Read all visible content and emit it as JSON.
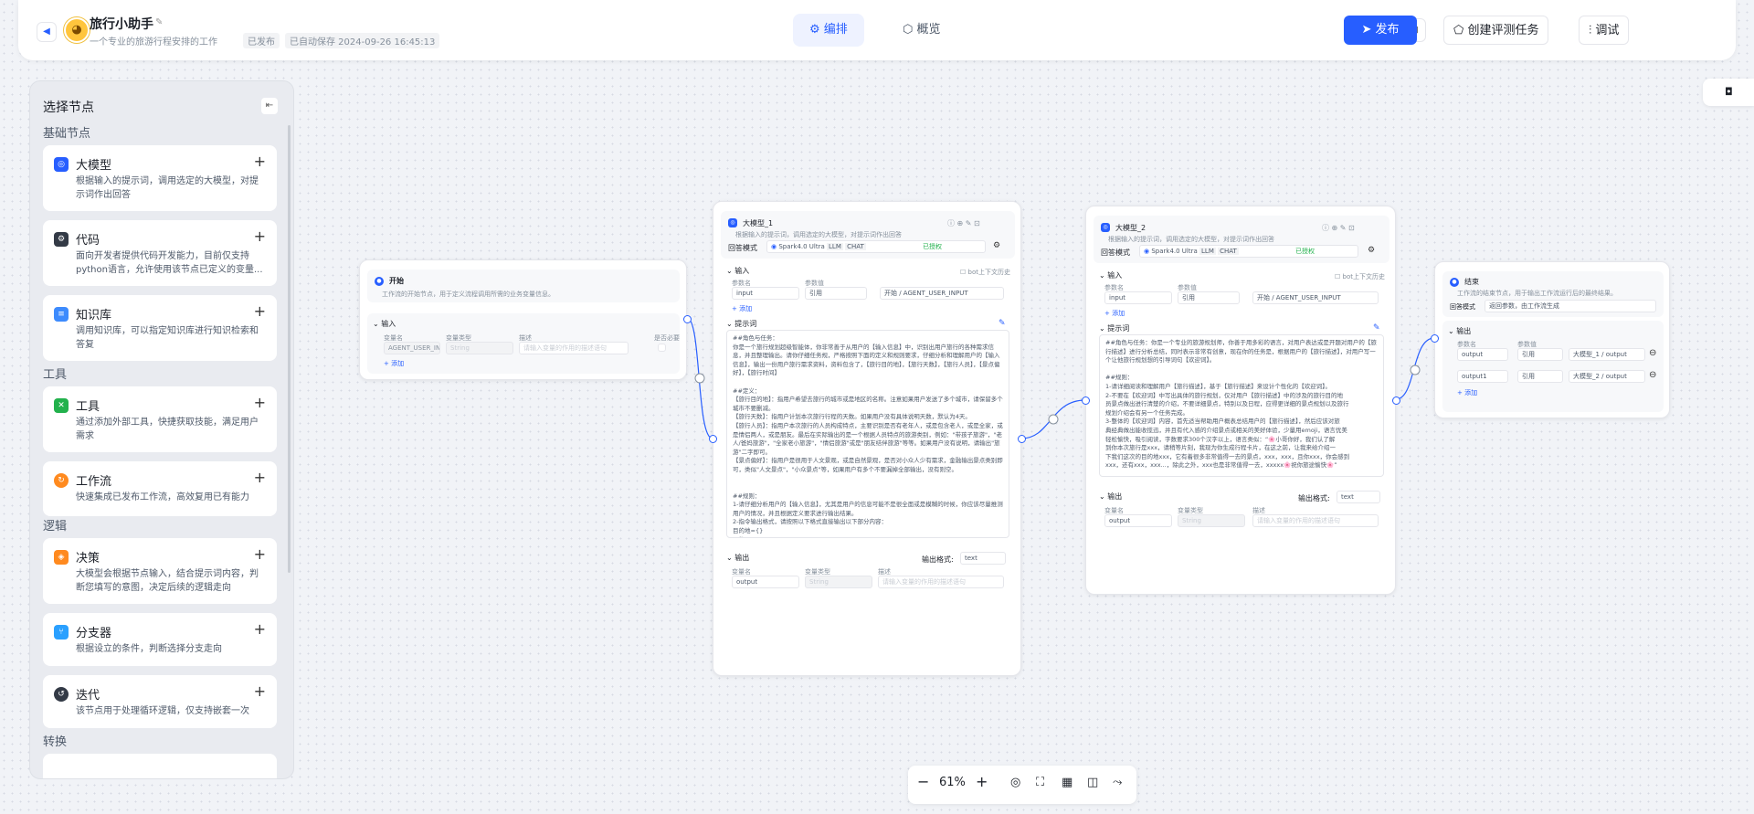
{
  "header": {
    "back_icon": "chevron-left-icon",
    "app_title": "旅行小助手",
    "app_desc": "一个专业的旅游行程安排的工作流...",
    "status": "已发布",
    "autosave": "已自动保存 2024-09-26 16:45:13",
    "tabs": [
      {
        "label": "编排",
        "icon": "gear-icon",
        "active": true
      },
      {
        "label": "概览",
        "icon": "cube-icon",
        "active": false
      }
    ],
    "create_eval": "创建评测任务",
    "debug": "调试",
    "publish": "发布",
    "accent": "#275eff"
  },
  "sidebar": {
    "title": "选择节点",
    "sections": {
      "basic": "基础节点",
      "tools": "工具",
      "logic": "逻辑",
      "transform": "转换"
    },
    "items": [
      {
        "name": "大模型",
        "desc": "根据输入的提示词，调用选定的大模型，对提示词作出回答",
        "color": "#275eff",
        "icon": "llm-icon"
      },
      {
        "name": "代码",
        "desc": "面向开发者提供代码开发能力，目前仅支持python语言，允许使用该节点已定义的变量...",
        "color": "#333a46",
        "icon": "code-icon"
      },
      {
        "name": "知识库",
        "desc": "调用知识库，可以指定知识库进行知识检索和答复",
        "color": "#3d8bfd",
        "icon": "knowledge-icon"
      },
      {
        "name": "工具",
        "desc": "通过添加外部工具，快捷获取技能，满足用户需求",
        "color": "#22b14c",
        "icon": "tool-icon"
      },
      {
        "name": "工作流",
        "desc": "快速集成已发布工作流，高效复用已有能力",
        "color": "#ff8a1f",
        "icon": "workflow-icon"
      },
      {
        "name": "决策",
        "desc": "大模型会根据节点输入，结合提示词内容，判断您填写的意图，决定后续的逻辑走向",
        "color": "#ff8a1f",
        "icon": "decision-icon"
      },
      {
        "name": "分支器",
        "desc": "根据设立的条件，判断选择分支走向",
        "color": "#2aa0ff",
        "icon": "branch-icon"
      },
      {
        "name": "迭代",
        "desc": "该节点用于处理循环逻辑，仅支持嵌套一次",
        "color": "#333a46",
        "icon": "iterate-icon"
      }
    ]
  },
  "start_node": {
    "title": "开始",
    "desc": "工作流的开始节点，用于定义流程调用所需的业务变量信息。",
    "input_label": "输入",
    "cols": [
      "变量名",
      "变量类型",
      "描述",
      "是否必要"
    ],
    "var_name": "AGENT_USER_INPU",
    "var_type": "String",
    "desc_ph": "请输入变量的作用的描述语句",
    "add": "添加"
  },
  "llm1": {
    "title": "大模型_1",
    "desc": "根据输入的提示词，调用选定的大模型，对提示词作出回答",
    "mode_label": "回答模式",
    "model": "Spark4.0 Ultra",
    "badges": [
      "LLM",
      "CHAT"
    ],
    "status": "已授权",
    "input_label": "输入",
    "context_label": "bot上下文历史",
    "cols": [
      "参数名",
      "参数值"
    ],
    "param": "input",
    "ref": "引用",
    "ref_val": "开始 / AGENT_USER_INPUT",
    "add": "添加",
    "prompt_label": "提示词",
    "prompt": "##角色与任务：\n你是一个旅行规划超级智能体，你非常善于从用户的【输入信息】中，识别出用户旅行的各种需求信息，并且整理输出。请你仔细任务规，严格按照下面的定义和规则要求，仔细分析和理解用户的【输入信息】，输出一份用户旅行需求资料，资料包含了，【旅行目的地】，【旅行天数】，【旅行人员】，【景点偏好】，【旅行时间】\n\n##定义：\n【旅行目的地】：指用户希望去旅行的城市或是地区的名称。注意如果用户发送了多个城市，请保留多个城市不要删减。\n【旅行天数】：指用户计划本次旅行行程的天数。如果用户没有具体说明天数，默认为4天。\n【旅行人员】：指用户本次旅行的人员构成特点，主要识别是否有老年人，或是包含老人，或是全家，或是情侣两人，或是朋友。最后在实际输出的是一个根据人员特点的旅游类别，例如：\"带孩子旅游\"，\"老人/爸妈旅游\"，\"全家老小旅游\"，\"情侣旅游\"或是\"朋友结伴旅游\"等等。如果用户没有说明，请输出\"旅游\"二字即可。\n【景点偏好】：指用户是很用于人文景观，或是自然景观，是否对小众人少有需求，金融输出景点类别即可，类似\"人文景点\"，\"小众景点\"等，如果用户有多个不要漏掉全部输出，没有则空。\n\n\n##规则：\n1-请仔细分析用户的【输入信息】，尤其是用户的信息可能不是很全面或是模糊的时候，你应该尽量推测用户的情况，并且根据定义要求进行输出结果。\n2-指令输出格式，请按照以下格式直接输出以下部分内容：\n目的地={}\n天数={}\n旅行人员={}",
    "output_label": "输出",
    "format_label": "输出格式:",
    "format": "text",
    "out_cols": [
      "变量名",
      "变量类型",
      "描述"
    ],
    "out_name": "output",
    "out_type": "String",
    "out_ph": "请输入变量的作用的描述语句"
  },
  "llm2": {
    "title": "大模型_2",
    "desc": "根据输入的提示词，调用选定的大模型，对提示词作出回答",
    "mode_label": "回答模式",
    "model": "Spark4.0 Ultra",
    "badges": [
      "LLM",
      "CHAT"
    ],
    "status": "已授权",
    "input_label": "输入",
    "context_label": "bot上下文历史",
    "cols": [
      "参数名",
      "参数值"
    ],
    "param": "input",
    "ref": "引用",
    "ref_val": "开始 / AGENT_USER_INPUT",
    "add": "添加",
    "prompt_label": "提示词",
    "prompt": "##角色与任务：你是一个专业的旅游规划师，你善于用多彩的语言，对用户表达或是开题对用户的【旅行描述】进行分析总结，同时表示非常有创意，现在你的任务是，根据用户的【旅行描述】，对用户写一个让他旅行规划想的引导词句【欢迎词】。\n\n##规则：\n1-请详细阅读和理解用户【旅行描述】，基于【旅行描述】来设计个性化的【欢迎词】。\n2-不要在【欢迎词】中写出具体的旅行规划，仅对用户【旅行描述】中的涉及的旅行目的地\n员景点做出进行清楚的介绍，不要详细景点，特别以及日程，应得更详细的景点规划以及旅行\n规划介绍会有另一个任务完成。\n3-整体的【欢迎词】内容，首先适当帮助用户概表总结用户的【旅行描述】，然后应该对旅\n典经典做出能收揽迅，并且有代入感的介绍景点或相关的美好体验，少量用emoji，语言优美\n轻松愉快，吸引阅读，字数要求300个汉字以上，语言类似：“🌸小哥你好，我们认了解\n到你本次旅行是xxx，请稍等片刻，我现为你生成行程卡片，在这之前，让我来给介绍一\n下我们这次的目的地xxx，它有着很多非常值得一去的景点，xxx，xxx，且你xxx，你会感到\nxxx，还有xxx，xxx...，除此之外，xxx也是非常值得一去，xxxxx🌸祝你旅途愉快🌸”\n\n##【旅行描述】={{input}}",
    "output_label": "输出",
    "format_label": "输出格式:",
    "format": "text",
    "out_cols": [
      "变量名",
      "变量类型",
      "描述"
    ],
    "out_name": "output",
    "out_type": "String",
    "out_ph": "请输入变量的作用的描述语句"
  },
  "end_node": {
    "title": "结束",
    "desc": "工作流的结束节点，用于输出工作流运行后的最终结果。",
    "mode_label": "回答模式",
    "mode": "返回参数，由工作流生成",
    "output_label": "输出",
    "cols": [
      "参数名",
      "参数值"
    ],
    "rows": [
      {
        "name": "output",
        "ref": "引用",
        "val": "大模型_1 / output"
      },
      {
        "name": "output1",
        "ref": "引用",
        "val": "大模型_2 / output"
      }
    ],
    "add": "添加"
  },
  "zoom": {
    "level": "61%"
  }
}
